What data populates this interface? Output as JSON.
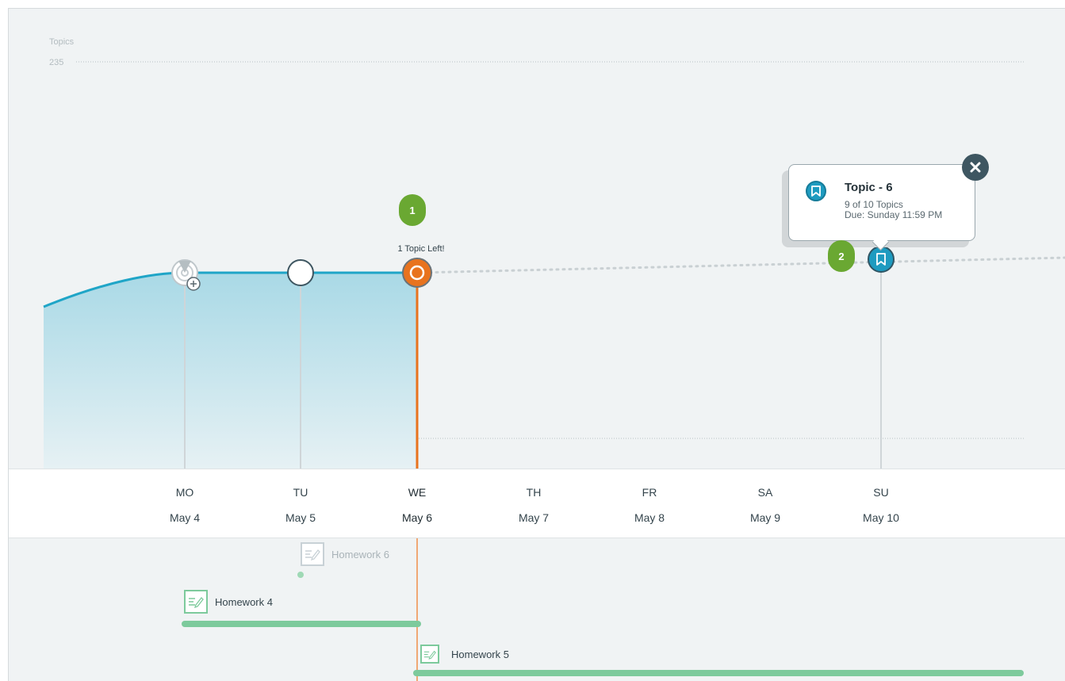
{
  "chart_data": {
    "type": "area",
    "ylabel": "Topics",
    "ylim": [
      210,
      235
    ],
    "yticks": [
      "235",
      "210"
    ],
    "days": [
      {
        "abbr": "MO",
        "date": "May 4"
      },
      {
        "abbr": "TU",
        "date": "May 5"
      },
      {
        "abbr": "WE",
        "date": "May 6"
      },
      {
        "abbr": "TH",
        "date": "May 7"
      },
      {
        "abbr": "FR",
        "date": "May 8"
      },
      {
        "abbr": "SA",
        "date": "May 9"
      },
      {
        "abbr": "SU",
        "date": "May 10"
      }
    ],
    "current_day": "WE",
    "series": [
      {
        "kind": "completed",
        "x": [
          "May 4",
          "May 5",
          "May 6"
        ],
        "y": [
          222,
          222,
          222
        ]
      },
      {
        "kind": "projected",
        "x": [
          "May 6",
          "May 10"
        ],
        "y": [
          222,
          222.7
        ]
      }
    ],
    "colors": {
      "line": "#1fa5c7",
      "fill": "#bfe3ec",
      "today": "#e8731e",
      "badge": "#6aa832",
      "homework": "#7dca9c"
    }
  },
  "markers": {
    "topics_left": "1 Topic Left!",
    "badge_current": "1",
    "badge_due": "2"
  },
  "tooltip": {
    "title": "Topic - 6",
    "progress": "9 of 10 Topics",
    "due": "Due: Sunday 11:59 PM",
    "icon": "bookmark-icon",
    "close_icon": "close-icon"
  },
  "homework": [
    {
      "name": "Homework 6",
      "start": "May 5",
      "end": "May 5",
      "state": "faded"
    },
    {
      "name": "Homework 4",
      "start": "May 4",
      "end": "May 6",
      "state": "active"
    },
    {
      "name": "Homework 5",
      "start": "May 6",
      "end": "May 10",
      "state": "active"
    }
  ]
}
